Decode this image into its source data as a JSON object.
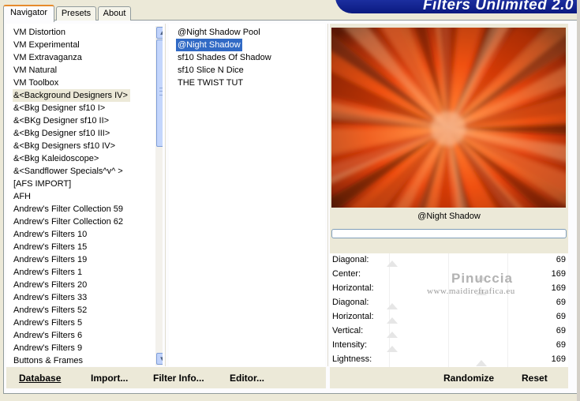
{
  "tabs": [
    {
      "label": "Navigator",
      "active": true
    },
    {
      "label": "Presets",
      "active": false
    },
    {
      "label": "About",
      "active": false
    }
  ],
  "banner": {
    "title": "Filters Unlimited 2.0"
  },
  "categories": [
    "VM Distortion",
    "VM Experimental",
    "VM Extravaganza",
    "VM Natural",
    "VM Toolbox",
    "&<Background Designers IV>",
    "&<Bkg Designer sf10 I>",
    "&<BKg Designer sf10 II>",
    "&<Bkg Designer sf10 III>",
    "&<Bkg Designers sf10 IV>",
    "&<Bkg Kaleidoscope>",
    "&<Sandflower Specials^v^ >",
    "[AFS IMPORT]",
    "AFH",
    "Andrew's Filter Collection 59",
    "Andrew's Filter Collection 62",
    "Andrew's Filters 10",
    "Andrew's Filters 15",
    "Andrew's Filters 19",
    "Andrew's Filters 1",
    "Andrew's Filters 20",
    "Andrew's Filters 33",
    "Andrew's Filters 52",
    "Andrew's Filters 5",
    "Andrew's Filters 6",
    "Andrew's Filters 9",
    "Buttons & Frames"
  ],
  "category_highlight_index": 5,
  "filters": [
    "@Night Shadow Pool",
    "@Night Shadow",
    "sf10 Shades Of Shadow",
    "sf10 Slice N Dice",
    "THE TWIST TUT"
  ],
  "filter_selected_index": 1,
  "preview": {
    "filter_name": "@Night Shadow"
  },
  "params": [
    {
      "label": "Diagonal:",
      "value": "69"
    },
    {
      "label": "Center:",
      "value": "169"
    },
    {
      "label": "Horizontal:",
      "value": "169"
    },
    {
      "label": "Diagonal:",
      "value": "69"
    },
    {
      "label": "Horizontal:",
      "value": "69"
    },
    {
      "label": "Vertical:",
      "value": "69"
    },
    {
      "label": "Intensity:",
      "value": "69"
    },
    {
      "label": "Lightness:",
      "value": "169"
    }
  ],
  "buttons": {
    "database": "Database",
    "import": "Import...",
    "filter_info": "Filter Info...",
    "editor": "Editor...",
    "randomize": "Randomize",
    "reset": "Reset"
  },
  "watermark": {
    "name": "Pinuccia",
    "url": "www.maidirefrafica.eu"
  },
  "colors": {
    "selection": "#316ac5",
    "tab_accent": "#e68b2c",
    "banner": "#0b1a80",
    "chrome": "#ece9d8"
  }
}
